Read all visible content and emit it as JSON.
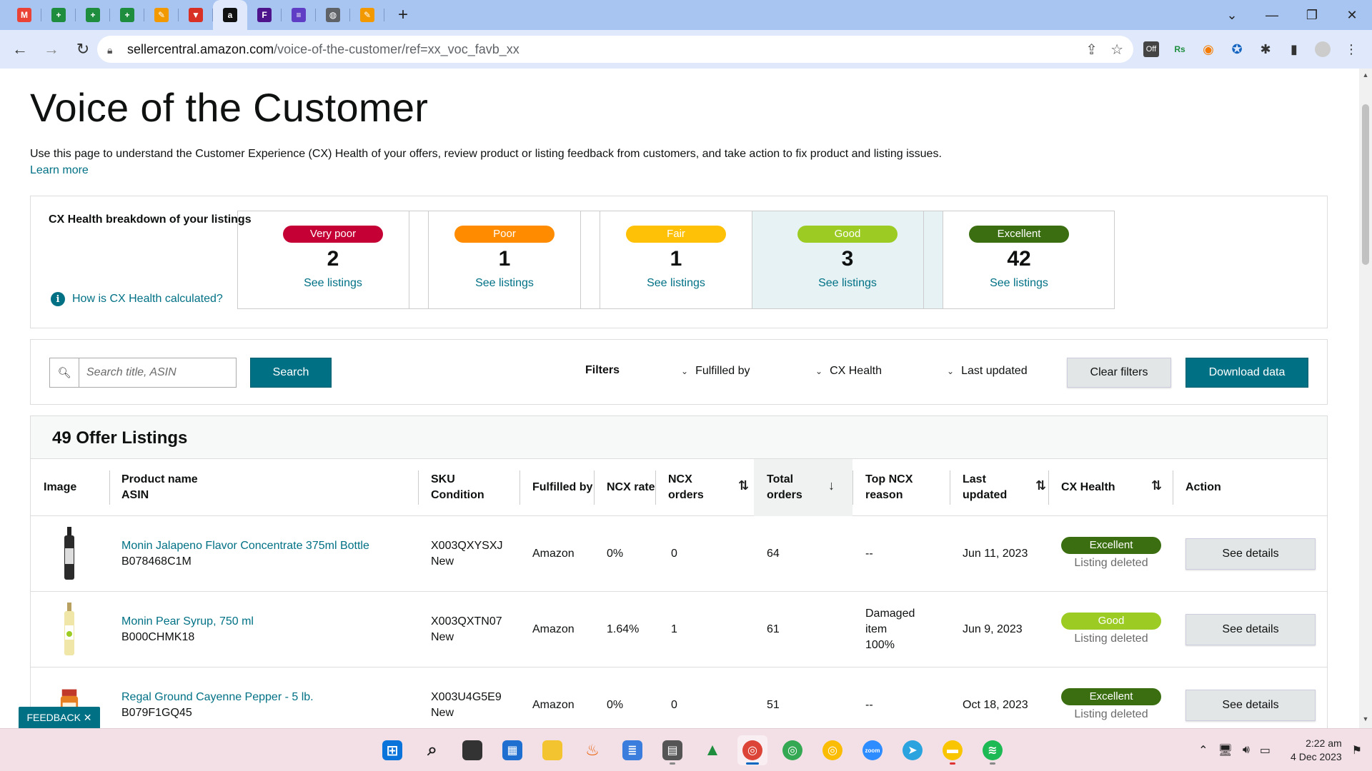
{
  "browser": {
    "tabs": [
      {
        "icon": "gmail-icon",
        "color": "#ea4335",
        "glyph": "M"
      },
      {
        "icon": "sheets-icon",
        "color": "#1e8e3e",
        "glyph": "+"
      },
      {
        "icon": "sheets-icon",
        "color": "#1e8e3e",
        "glyph": "+"
      },
      {
        "icon": "sheets-icon",
        "color": "#1e8e3e",
        "glyph": "+"
      },
      {
        "icon": "pen-icon",
        "color": "#f29900",
        "glyph": "✎"
      },
      {
        "icon": "triangle-icon",
        "color": "#d93025",
        "glyph": "▼"
      },
      {
        "icon": "amazon-icon",
        "color": "#111111",
        "glyph": "a",
        "active": true
      },
      {
        "icon": "fedex-icon",
        "color": "#4d148c",
        "glyph": "F"
      },
      {
        "icon": "list-icon",
        "color": "#5f3dc4",
        "glyph": "≡"
      },
      {
        "icon": "globe-icon",
        "color": "#5f6368",
        "glyph": "◍"
      },
      {
        "icon": "pen-icon",
        "color": "#f29900",
        "glyph": "✎"
      }
    ],
    "new_tab": "+",
    "url_host": "sellercentral.amazon.com",
    "url_path": "/voice-of-the-customer/ref=xx_voc_favb_xx"
  },
  "page": {
    "title": "Voice of the Customer",
    "intro": "Use this page to understand the Customer Experience (CX) Health of your offers, review product or listing feedback from customers, and take action to fix product and listing issues.",
    "learn_more": "Learn more",
    "cx_breakdown_label": "CX Health breakdown of your listings",
    "cx_how_link": "How is CX Health calculated?",
    "cx_cards": [
      {
        "label": "Very poor",
        "count": "2",
        "link": "See listings",
        "color": "#c40034"
      },
      {
        "label": "Poor",
        "count": "1",
        "link": "See listings",
        "color": "#ff8c00"
      },
      {
        "label": "Fair",
        "count": "1",
        "link": "See listings",
        "color": "#ffc107"
      },
      {
        "label": "Good",
        "count": "3",
        "link": "See listings",
        "color": "#9ccc23",
        "selected": true
      },
      {
        "label": "Excellent",
        "count": "42",
        "link": "See listings",
        "color": "#3a6e10"
      }
    ],
    "search_placeholder": "Search title, ASIN",
    "search_button": "Search",
    "filters_label": "Filters",
    "filter_fulfilled": "Fulfilled by",
    "filter_cx": "CX Health",
    "filter_updated": "Last updated",
    "clear_filters": "Clear filters",
    "download_data": "Download data",
    "listings_title": "49 Offer Listings",
    "columns": {
      "image": "Image",
      "product_1": "Product name",
      "product_2": "ASIN",
      "sku_1": "SKU",
      "sku_2": "Condition",
      "fulfilled": "Fulfilled by",
      "ncx_rate": "NCX rate",
      "ncx_orders_1": "NCX",
      "ncx_orders_2": "orders",
      "total_1": "Total",
      "total_2": "orders",
      "reason_1": "Top NCX",
      "reason_2": "reason",
      "updated_1": "Last",
      "updated_2": "updated",
      "cx_health": "CX Health",
      "action": "Action"
    },
    "rows": [
      {
        "product": "Monin Jalapeno Flavor Concentrate 375ml Bottle",
        "asin": "B078468C1M",
        "sku": "X003QXYSXJ",
        "condition": "New",
        "fulfilled": "Amazon",
        "ncx_rate": "0%",
        "ncx_orders": "0",
        "total_orders": "64",
        "reason_1": "--",
        "reason_2": "",
        "reason_3": "",
        "updated": "Jun 11, 2023",
        "health": "Excellent",
        "health_color": "#3a6e10",
        "status": "Listing deleted",
        "action": "See details",
        "image": "bottle-dark"
      },
      {
        "product": "Monin Pear Syrup, 750 ml",
        "asin": "B000CHMK18",
        "sku": "X003QXTN07",
        "condition": "New",
        "fulfilled": "Amazon",
        "ncx_rate": "1.64%",
        "ncx_orders": "1",
        "total_orders": "61",
        "reason_1": "Damaged",
        "reason_2": "item",
        "reason_3": "100%",
        "updated": "Jun 9, 2023",
        "health": "Good",
        "health_color": "#9ccc23",
        "status": "Listing deleted",
        "action": "See details",
        "image": "bottle-light"
      },
      {
        "product": "Regal Ground Cayenne Pepper - 5 lb.",
        "asin": "B079F1GQ45",
        "sku": "X003U4G5E9",
        "condition": "New",
        "fulfilled": "Amazon",
        "ncx_rate": "0%",
        "ncx_orders": "0",
        "total_orders": "51",
        "reason_1": "--",
        "reason_2": "",
        "reason_3": "",
        "updated": "Oct 18, 2023",
        "health": "Excellent",
        "health_color": "#3a6e10",
        "status": "Listing deleted",
        "action": "See details",
        "image": "jar-red"
      }
    ],
    "feedback": "FEEDBACK ✕"
  },
  "taskbar": {
    "time": "2:22 am",
    "date": "4 Dec 2023"
  }
}
